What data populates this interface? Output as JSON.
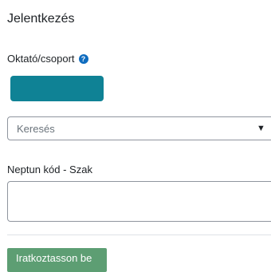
{
  "form": {
    "title": "Jelentkezés",
    "teacher_group_label": "Oktató/csoport",
    "help_icon_glyph": "?",
    "help_icon_name": "question-circle-icon",
    "teacher_group_button_color": "#0f8295",
    "search": {
      "placeholder": "Keresés",
      "arrow_glyph": "▼",
      "arrow_icon_name": "dropdown-triangle-icon"
    },
    "neptun_label": "Neptun kód - Szak",
    "neptun_value": "",
    "submit_label": "Iratkoztasson be",
    "submit_color": "#5d9e73"
  }
}
